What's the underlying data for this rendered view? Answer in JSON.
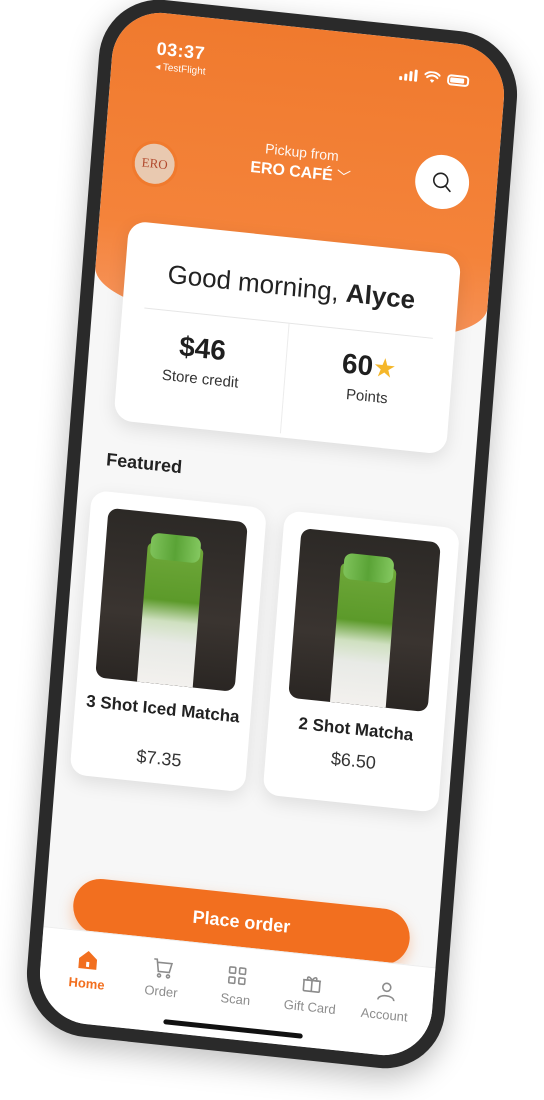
{
  "status_bar": {
    "time": "03:37",
    "back_app": "◂ TestFlight"
  },
  "header": {
    "logo_text": "ERO",
    "pickup_label": "Pickup from",
    "store_name": "ERO CAFÉ"
  },
  "greeting": {
    "prefix": "Good morning,",
    "name": "Alyce"
  },
  "stats": {
    "credit_value": "$46",
    "credit_label": "Store credit",
    "points_value": "60",
    "points_label": "Points"
  },
  "featured": {
    "title": "Featured",
    "items": [
      {
        "name": "3 Shot Iced Matcha",
        "price": "$7.35"
      },
      {
        "name": "2 Shot Matcha",
        "price": "$6.50"
      }
    ]
  },
  "actions": {
    "place_order": "Place order"
  },
  "tabs": [
    {
      "label": "Home",
      "icon": "home-icon",
      "active": true
    },
    {
      "label": "Order",
      "icon": "cart-icon",
      "active": false
    },
    {
      "label": "Scan",
      "icon": "scan-icon",
      "active": false
    },
    {
      "label": "Gift Card",
      "icon": "gift-icon",
      "active": false
    },
    {
      "label": "Account",
      "icon": "person-icon",
      "active": false
    }
  ],
  "colors": {
    "accent": "#f26f1f",
    "star": "#f5b72a",
    "background": "#f7f7f7"
  }
}
